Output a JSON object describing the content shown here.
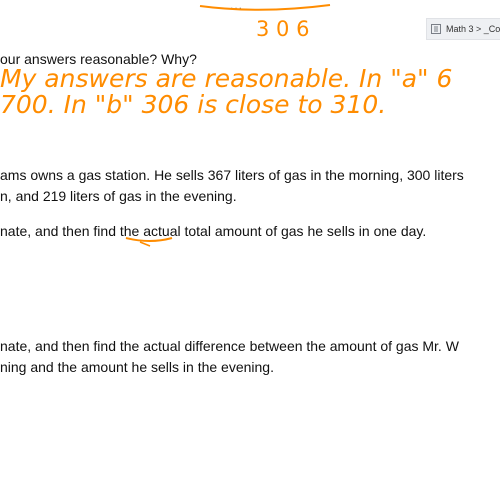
{
  "window": {
    "more_label": "...",
    "tab_label": "Math 3 > _Co"
  },
  "handwriting": {
    "top_number": "3 0 6",
    "line1": "My answers are reasonable. In \"a\" 6",
    "line2": "700. In \"b\" 306 is close to 310."
  },
  "document": {
    "question_reasonable": "our answers reasonable?  Why?",
    "problem_line1": "ams owns a gas station.  He sells 367 liters of gas in the morning, 300 liters",
    "problem_line2": "n, and 219 liters of gas in the evening.",
    "part_a": "nate, and then find the actual total amount of gas he sells in one day.",
    "part_b_line1": "nate, and then find the actual difference between the amount of gas Mr. W",
    "part_b_line2": "ning and the amount he sells in the evening."
  },
  "colors": {
    "ink": "#ff8c00",
    "text": "#111111"
  }
}
